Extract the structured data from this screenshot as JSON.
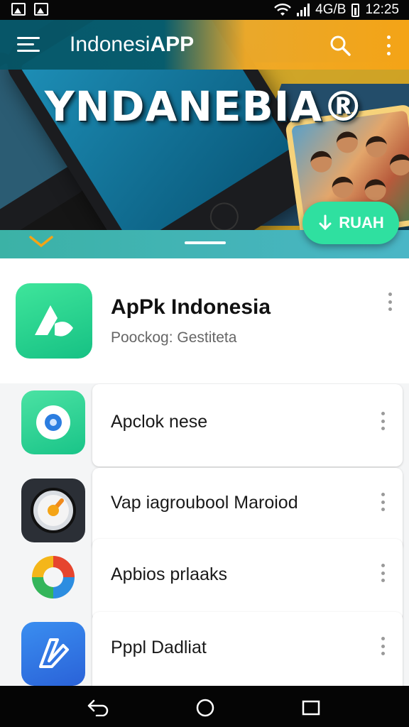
{
  "status_bar": {
    "network": "4G/B",
    "time": "12:25"
  },
  "app_bar": {
    "title_prefix": "Indonesi",
    "title_accent": "APP"
  },
  "hero": {
    "headline": "YNDANEBIA®",
    "cta_label": "RUAH",
    "cta_icon": "download-arrow-icon"
  },
  "featured": {
    "name": "ApPk Indonesia",
    "subtitle": "Poockog: Gestiteta"
  },
  "list": [
    {
      "name": "Apclok nese",
      "icon": "compass-icon"
    },
    {
      "name": "Vap iagroubool Maroiod",
      "icon": "speedometer-icon"
    },
    {
      "name": "Apbios prlaaks",
      "icon": "color-ring-icon"
    },
    {
      "name": "Pppl Dadliat",
      "icon": "edit-shape-icon"
    }
  ],
  "colors": {
    "accent_green": "#2fe0a0",
    "app_bar_teal": "#065668",
    "app_bar_orange": "#f4a416"
  }
}
